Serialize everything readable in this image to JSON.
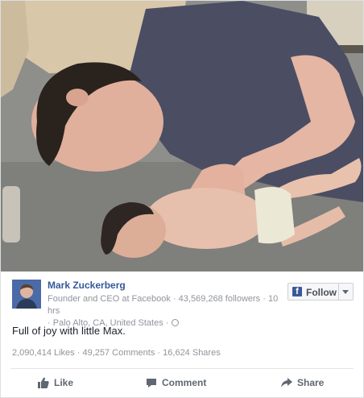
{
  "post": {
    "author_name": "Mark Zuckerberg",
    "author_title": "Founder and CEO at Facebook",
    "followers": "43,569,268 followers",
    "time": "10 hrs",
    "location": "Palo Alto, CA, United States",
    "text": "Full of joy with little Max.",
    "stats": {
      "likes": "2,090,414 Likes",
      "comments": "49,257 Comments",
      "shares": "16,624 Shares"
    },
    "follow_button": {
      "label": "Follow",
      "icon": "facebook-f-icon"
    },
    "actions": [
      {
        "label": "Like",
        "icon": "thumbs-up-icon"
      },
      {
        "label": "Comment",
        "icon": "comment-bubble-icon"
      },
      {
        "label": "Share",
        "icon": "share-arrow-icon"
      }
    ]
  },
  "colors": {
    "link_blue": "#365899",
    "brand_blue": "#3b5998",
    "meta_gray": "#90949c",
    "action_gray": "#606770"
  }
}
